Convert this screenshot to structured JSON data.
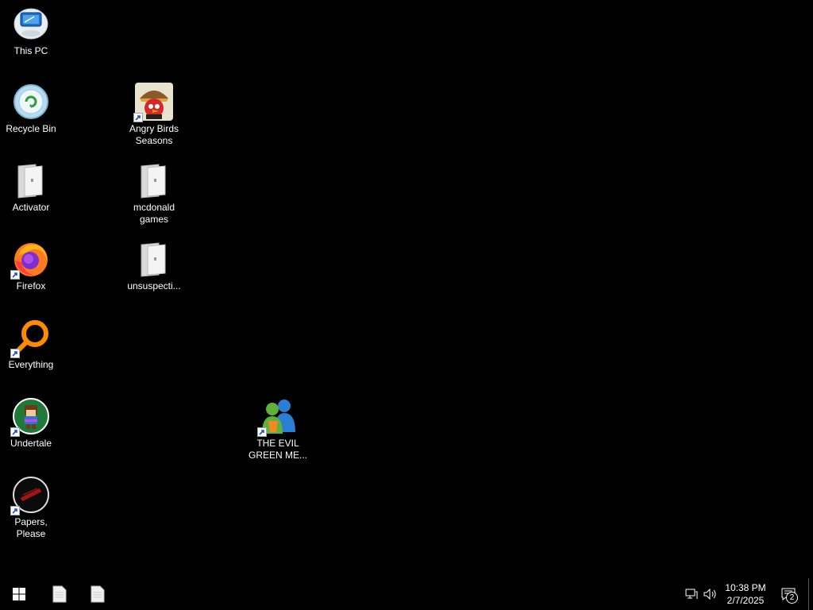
{
  "desktop": {
    "icons": [
      {
        "label": "This PC",
        "icon": "this-pc-icon",
        "shortcut": false
      },
      {
        "label": "Recycle Bin",
        "icon": "recycle-bin-icon",
        "shortcut": false
      },
      {
        "label": "Activator",
        "icon": "folder-icon",
        "shortcut": false
      },
      {
        "label": "Firefox",
        "icon": "firefox-icon",
        "shortcut": true
      },
      {
        "label": "Everything",
        "icon": "everything-search-icon",
        "shortcut": true
      },
      {
        "label": "Undertale",
        "icon": "undertale-icon",
        "shortcut": true
      },
      {
        "label": "Papers, Please",
        "icon": "papers-please-icon",
        "shortcut": true
      },
      {
        "label": "Angry Birds Seasons",
        "icon": "angry-birds-icon",
        "shortcut": true
      },
      {
        "label": "mcdonald games",
        "icon": "folder-icon",
        "shortcut": false
      },
      {
        "label": "unsuspecti...",
        "icon": "folder-icon",
        "shortcut": false
      },
      {
        "label": "THE EVIL GREEN ME...",
        "icon": "messenger-icon",
        "shortcut": true
      }
    ]
  },
  "taskbar": {
    "start_icon": "windows-logo-icon",
    "pinned": [
      "document-icon",
      "document-icon"
    ],
    "tray": {
      "network_icon": "network-icon",
      "volume_icon": "volume-icon",
      "time": "10:38 PM",
      "date": "2/7/2025",
      "notifications_icon": "action-center-icon",
      "notification_count": "2"
    }
  }
}
